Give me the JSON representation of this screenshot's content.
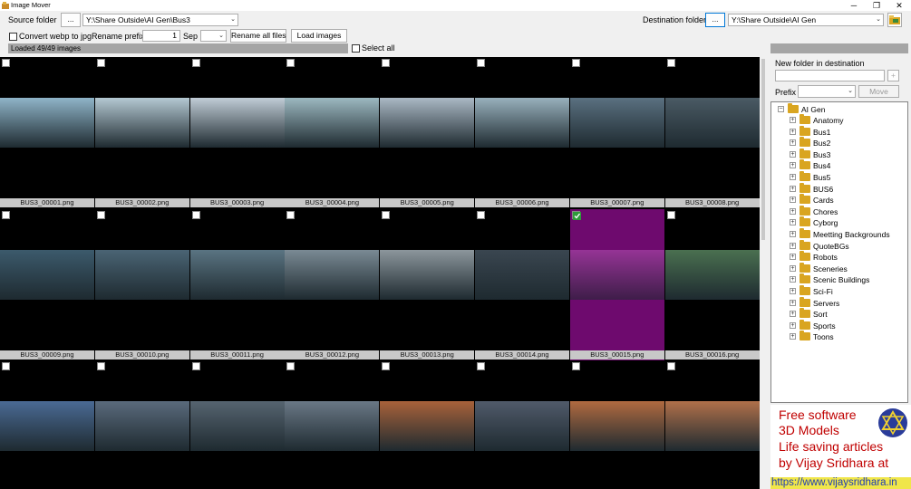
{
  "window": {
    "title": "Image Mover",
    "minimize": "─",
    "maximize": "❐",
    "close": "✕"
  },
  "toolbar": {
    "source_label": "Source folder",
    "source_browse": "...",
    "source_path": "Y:\\Share Outside\\AI Gen\\Bus3",
    "dest_label": "Destination folder",
    "dest_browse": "...",
    "dest_path": "Y:\\Share Outside\\AI Gen",
    "convert_label": "Convert webp to jpg",
    "rename_prefix_label": "Rename prefix",
    "rename_start": "1",
    "sep_label": "Sep",
    "sep_value": "",
    "rename_all_button": "Rename all files",
    "load_button": "Load images",
    "select_all_label": "Select all",
    "status": "Loaded 49/49 images"
  },
  "right_panel": {
    "new_folder_label": "New folder in destination",
    "new_folder_value": "",
    "add_button": "+",
    "prefix_label": "Prefix",
    "prefix_value": "",
    "move_button": "Move"
  },
  "tree": {
    "root": "AI Gen",
    "items": [
      "Anatomy",
      "Bus1",
      "Bus2",
      "Bus3",
      "Bus4",
      "Bus5",
      "BUS6",
      "Cards",
      "Chores",
      "Cyborg",
      "Meetting Backgrounds",
      "QuoteBGs",
      "Robots",
      "Sceneries",
      "Scenic Buildings",
      "Sci-Fi",
      "Servers",
      "Sort",
      "Sports",
      "Toons"
    ]
  },
  "images": [
    {
      "name": "BUS3_00001.png",
      "checked": false,
      "color": "#8fb4c8"
    },
    {
      "name": "BUS3_00002.png",
      "checked": false,
      "color": "#b4c8d2"
    },
    {
      "name": "BUS3_00003.png",
      "checked": false,
      "color": "#c0ccd6"
    },
    {
      "name": "BUS3_00004.png",
      "checked": false,
      "color": "#9cb8c0"
    },
    {
      "name": "BUS3_00005.png",
      "checked": false,
      "color": "#aab8c4"
    },
    {
      "name": "BUS3_00006.png",
      "checked": false,
      "color": "#98b0bc"
    },
    {
      "name": "BUS3_00007.png",
      "checked": false,
      "color": "#5a7080"
    },
    {
      "name": "BUS3_00008.png",
      "checked": false,
      "color": "#4a5a64"
    },
    {
      "name": "BUS3_00009.png",
      "checked": false,
      "color": "#3c5a6c"
    },
    {
      "name": "BUS3_00010.png",
      "checked": false,
      "color": "#4a6474"
    },
    {
      "name": "BUS3_00011.png",
      "checked": false,
      "color": "#5a7482"
    },
    {
      "name": "BUS3_00012.png",
      "checked": false,
      "color": "#7a8a94"
    },
    {
      "name": "BUS3_00013.png",
      "checked": false,
      "color": "#8c969c"
    },
    {
      "name": "BUS3_00014.png",
      "checked": false,
      "color": "#3a4650"
    },
    {
      "name": "BUS3_00015.png",
      "checked": true,
      "color": "#b050b0"
    },
    {
      "name": "BUS3_00016.png",
      "checked": false,
      "color": "#4a7050"
    },
    {
      "name": "",
      "checked": false,
      "color": "#4a6a94"
    },
    {
      "name": "",
      "checked": false,
      "color": "#5a6a7c"
    },
    {
      "name": "",
      "checked": false,
      "color": "#566470"
    },
    {
      "name": "",
      "checked": false,
      "color": "#6a7886"
    },
    {
      "name": "",
      "checked": false,
      "color": "#a8623a"
    },
    {
      "name": "",
      "checked": false,
      "color": "#505a6a"
    },
    {
      "name": "",
      "checked": false,
      "color": "#b06a40"
    },
    {
      "name": "",
      "checked": false,
      "color": "#b0704a"
    }
  ],
  "banner": {
    "line1": "Free software",
    "line2": "3D Models",
    "line3": "Life saving articles",
    "line4": "by Vijay Sridhara at",
    "url": "https://www.vijaysridhara.in"
  }
}
